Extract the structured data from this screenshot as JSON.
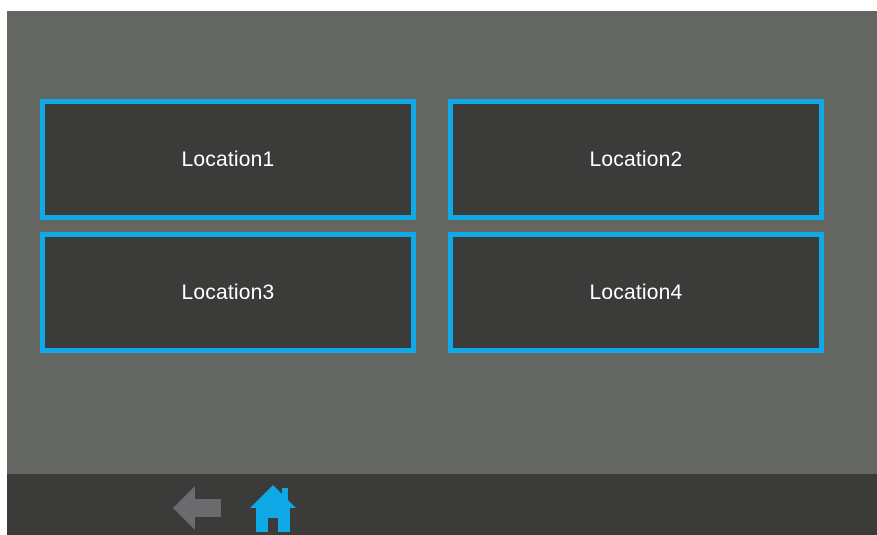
{
  "locations": [
    {
      "label": "Location1"
    },
    {
      "label": "Location2"
    },
    {
      "label": "Location3"
    },
    {
      "label": "Location4"
    }
  ],
  "nav": {
    "back_icon": "back-arrow-icon",
    "home_icon": "home-icon"
  },
  "colors": {
    "background": "#646662",
    "button_fill": "#3b3c39",
    "button_border": "#10a9e8",
    "navbar": "#3b3c39",
    "back_icon": "#6b6a6e",
    "home_icon": "#10a9e8"
  }
}
